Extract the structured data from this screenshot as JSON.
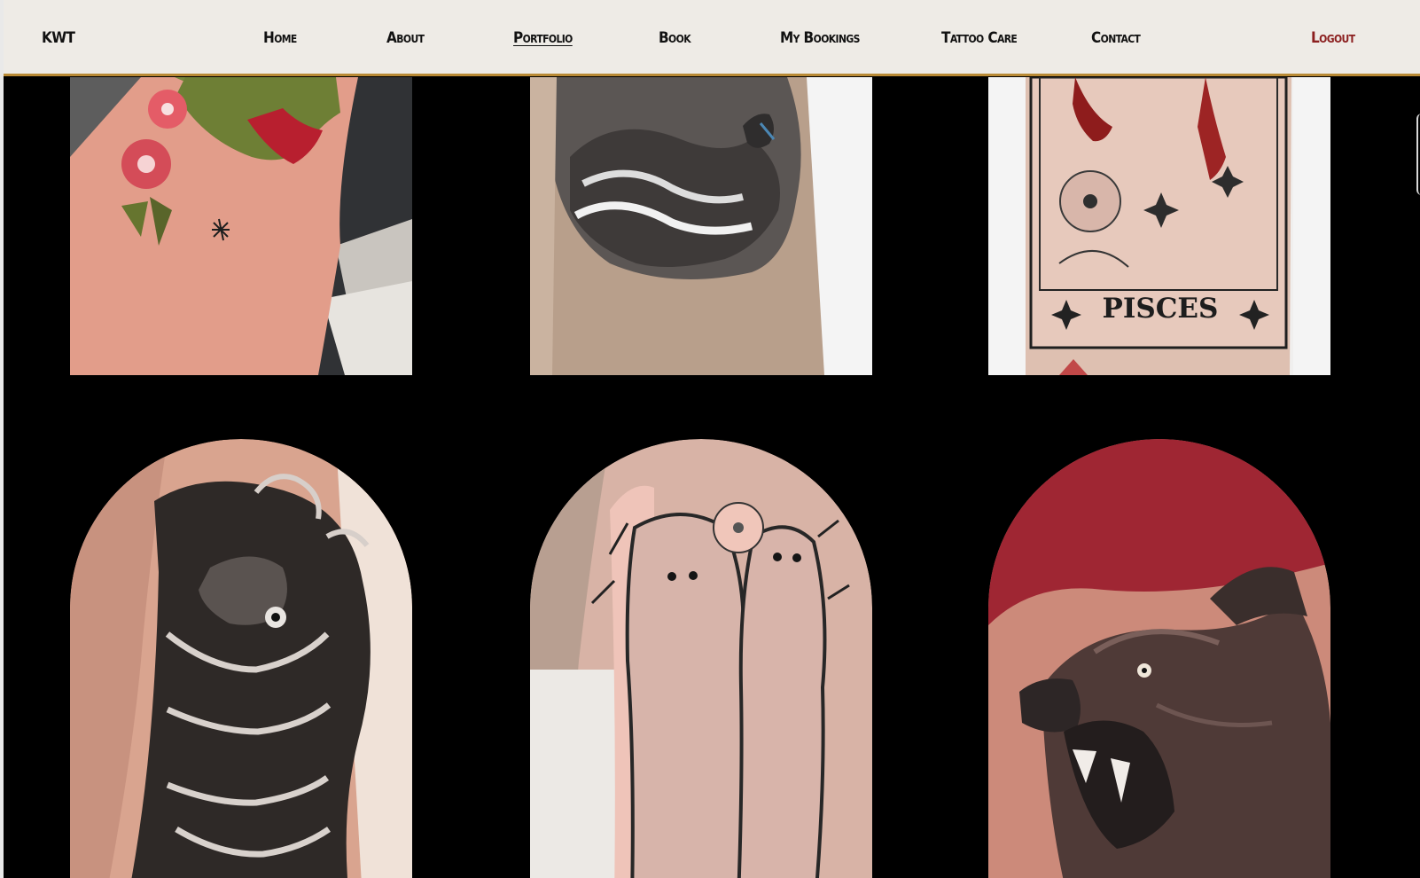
{
  "nav": {
    "brand": "KWT",
    "items": [
      {
        "label": "Home",
        "active": false
      },
      {
        "label": "About",
        "active": false
      },
      {
        "label": "Portfolio",
        "active": true
      },
      {
        "label": "Book",
        "active": false
      },
      {
        "label": "My Bookings",
        "active": false
      },
      {
        "label": "Tattoo Care",
        "active": false
      },
      {
        "label": "Contact",
        "active": false
      }
    ],
    "logout": "Logout"
  },
  "gallery": {
    "tiles": [
      {
        "name": "tattoo-trex-flowers",
        "shape": "rect"
      },
      {
        "name": "tattoo-dinosaurs-rocks",
        "shape": "rect"
      },
      {
        "name": "tattoo-pisces-card",
        "shape": "rect",
        "card_text": "PISCES"
      },
      {
        "name": "tattoo-koi-fish",
        "shape": "oval"
      },
      {
        "name": "tattoo-ghosts-flowers",
        "shape": "oval"
      },
      {
        "name": "tattoo-snarling-wolf",
        "shape": "oval"
      }
    ]
  },
  "colors": {
    "navbar_bg": "#eeebe6",
    "navbar_border": "#b98a35",
    "logout": "#8b1f1f",
    "page_bg": "#000000"
  }
}
